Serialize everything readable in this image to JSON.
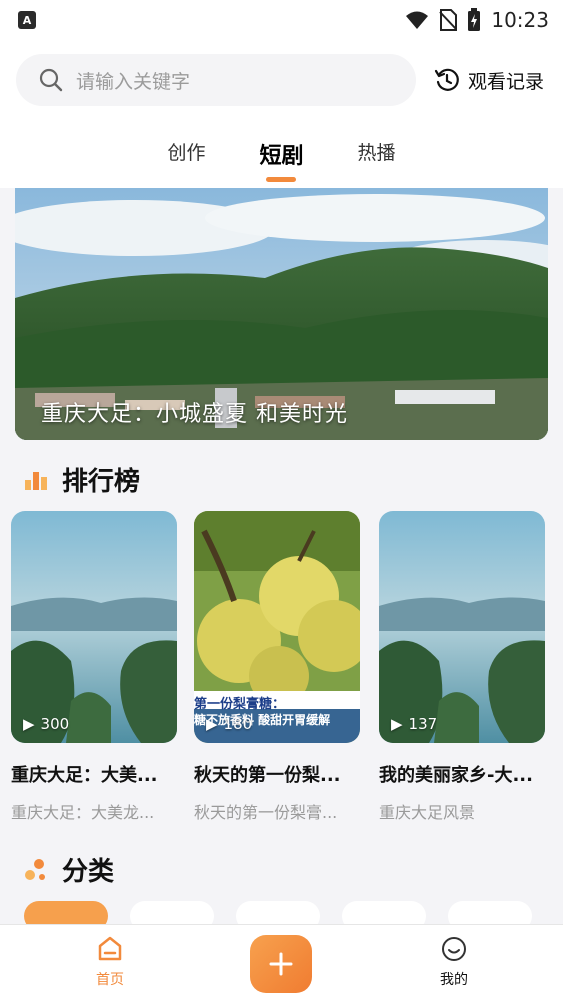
{
  "status_bar": {
    "time": "10:23",
    "left_icon": "A"
  },
  "search": {
    "placeholder": "请输入关键字",
    "history_label": "观看记录"
  },
  "tabs": [
    {
      "label": "创作"
    },
    {
      "label": "短剧",
      "active": true
    },
    {
      "label": "热播"
    }
  ],
  "banner": {
    "title": "重庆大足：小城盛夏 和美时光"
  },
  "ranking": {
    "title": "排行榜",
    "cards": [
      {
        "plays": "300",
        "title": "重庆大足：大美...",
        "subtitle": "重庆大足：大美龙..."
      },
      {
        "plays": "180",
        "title": "秋天的第一份梨...",
        "subtitle": "秋天的第一份梨膏...",
        "caption_line1": "第一份梨膏糖：",
        "caption_line2": "糖不放香料  酸甜开胃缓解"
      },
      {
        "plays": "137",
        "title": "我的美丽家乡-大...",
        "subtitle": "重庆大足风景"
      }
    ]
  },
  "category": {
    "title": "分类"
  },
  "bottom_nav": {
    "home_label": "首页",
    "mine_label": "我的"
  },
  "colors": {
    "accent": "#f28a3c",
    "background": "#f4f4f7"
  }
}
